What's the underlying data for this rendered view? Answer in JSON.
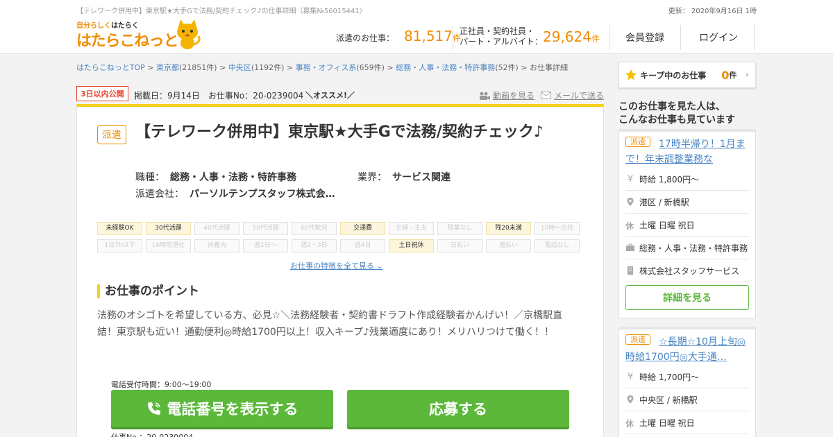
{
  "header": {
    "meta_title": "【テレワーク併用中】東京駅★大手Gで法務/契約チェック♪の仕事詳細（募集№56015441）",
    "updated": "更新： 2020年9月16日 1時",
    "logo_tag_1": "自分らしく",
    "logo_tag_2": "はたらく",
    "logo_name": "はたらこねっと",
    "haken_label": "派遣のお仕事：",
    "haken_count": "81,517",
    "unit": "件",
    "seishain_label_1": "正社員・契約社員・",
    "seishain_label_2": "パート・アルバイト：",
    "seishain_count": "29,624",
    "register": "会員登録",
    "login": "ログイン"
  },
  "breadcrumb": [
    {
      "label": "はたらこねっとTOP",
      "link": true
    },
    {
      "label": "東京都",
      "link": true,
      "count": "(21851件)"
    },
    {
      "label": "中央区",
      "link": true,
      "count": "(1192件)"
    },
    {
      "label": "事務・オフィス系",
      "link": true,
      "count": "(659件)"
    },
    {
      "label": "総務・人事・法務・特許事務",
      "link": true,
      "count": "(52件)"
    },
    {
      "label": "お仕事詳細",
      "link": false
    }
  ],
  "job": {
    "new_badge": "3日以内公開",
    "posted": "掲載日：9月14日　お仕事No：20-0239004",
    "osusume": "＼オススメ!／",
    "video": "動画を見る",
    "mail": "メールで送る",
    "type_badge": "派遣",
    "title": "【テレワーク併用中】東京駅★大手Gで法務/契約チェック♪",
    "shokushu_label": "職種：",
    "shokushu": "総務・人事・法務・特許事務",
    "gyokai_label": "業界：",
    "gyokai": "サービス関連",
    "company_label": "派遣会社：",
    "company": "パーソルテンプスタッフ株式会…",
    "features": [
      {
        "label": "未経験OK",
        "on": true
      },
      {
        "label": "30代活躍",
        "on": true
      },
      {
        "label": "40代活躍",
        "on": false
      },
      {
        "label": "50代活躍",
        "on": false
      },
      {
        "label": "60代歓迎",
        "on": false
      },
      {
        "label": "交通費",
        "on": true
      },
      {
        "label": "主婦・主夫",
        "on": false
      },
      {
        "label": "残業なし",
        "on": false
      },
      {
        "label": "残20未満",
        "on": true
      },
      {
        "label": "10時～出社",
        "on": false
      },
      {
        "label": "1日7h以下",
        "on": false
      },
      {
        "label": "16時前退社",
        "on": false
      },
      {
        "label": "扶養内",
        "on": false
      },
      {
        "label": "週1日～",
        "on": false
      },
      {
        "label": "週2・3日",
        "on": false
      },
      {
        "label": "週4日",
        "on": false
      },
      {
        "label": "土日祝休",
        "on": true
      },
      {
        "label": "日払い",
        "on": false
      },
      {
        "label": "週払い",
        "on": false
      },
      {
        "label": "電話なし",
        "on": false
      }
    ],
    "show_all": "お仕事の特徴を全て見る",
    "point_title": "お仕事のポイント",
    "point_text": "法務のオシゴトを希望している方、必見☆＼法務経験者・契約書ドラフト作成経験者かんげい！／京橋駅直結！東京駅も近い！通勤便利◎時給1700円以上！収入キープ♪残業適度にあり！メリハリつけて働く！！",
    "phone_hours": "電話受付時間：9:00～19:00",
    "phone_button": "電話番号を表示する",
    "apply_button": "応募する",
    "job_no": "仕事No.：20-0239004"
  },
  "sidebar": {
    "keep_label": "キープ中のお仕事",
    "keep_count": "0",
    "keep_unit": "件",
    "title_1": "このお仕事を見た人は、",
    "title_2": "こんなお仕事も見ています",
    "cards": [
      {
        "badge": "派遣",
        "title": "17時半帰り！1月まで！年末調整業務な",
        "wage": "時給 1,800円～",
        "station": "港区 / 新橋駅",
        "holiday": "土曜 日曜 祝日",
        "category": "総務・人事・法務・特許事務",
        "company": "株式会社スタッフサービス",
        "more": "詳細を見る"
      },
      {
        "badge": "派遣",
        "title": "☆長期☆10月上旬◎時給1700円◎大手通…",
        "wage": "時給 1,700円～",
        "station": "中央区 / 新橋駅",
        "holiday": "土曜 日曜 祝日"
      }
    ]
  },
  "colors": {
    "brand": "#f08c00",
    "accent_yellow": "#f5d11b",
    "button_green": "#5cb83a",
    "link": "#4a86c5",
    "new_red": "#e8412a"
  }
}
